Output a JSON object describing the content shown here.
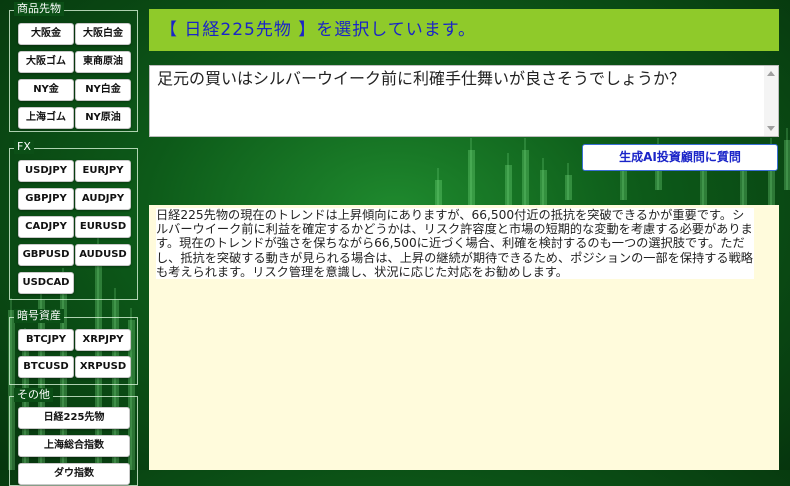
{
  "sidebar": {
    "commodities": {
      "title": "商品先物",
      "buttons": [
        "大阪金",
        "大阪白金",
        "大阪ゴム",
        "東商原油",
        "NY金",
        "NY白金",
        "上海ゴム",
        "NY原油"
      ]
    },
    "fx": {
      "title": "FX",
      "buttons": [
        "USDJPY",
        "EURJPY",
        "GBPJPY",
        "AUDJPY",
        "CADJPY",
        "EURUSD",
        "GBPUSD",
        "AUDUSD",
        "USDCAD"
      ]
    },
    "crypto": {
      "title": "暗号資産",
      "buttons": [
        "BTCJPY",
        "XRPJPY",
        "BTCUSD",
        "XRPUSD"
      ]
    },
    "other": {
      "title": "その他",
      "buttons": [
        "日経225先物",
        "上海総合指数",
        "ダウ指数"
      ]
    }
  },
  "banner": {
    "text": "【 日経225先物 】を選択しています。"
  },
  "question": {
    "text": "足元の買いはシルバーウイーク前に利確手仕舞いが良さそうでしょうか？"
  },
  "ask_button": {
    "label": "生成AI投資顧問に質問"
  },
  "answer": {
    "text": "日経225先物の現在のトレンドは上昇傾向にありますが、66,500付近の抵抗を突破できるかが重要です。シルバーウイーク前に利益を確定するかどうかは、リスク許容度と市場の短期的な変動を考慮する必要があります。現在のトレンドが強さを保ちながら66,500に近づく場合、利確を検討するのも一つの選択肢です。ただし、抵抗を突破する動きが見られる場合は、上昇の継続が期待できるため、ポジションの一部を保持する戦略も考えられます。リスク管理を意識し、状況に応じた対応をお勧めします。"
  },
  "colors": {
    "banner_bg": "#8fca2a",
    "banner_text": "#1a24c8",
    "answer_bg": "#fffbdc",
    "background": "#0d5a19"
  }
}
